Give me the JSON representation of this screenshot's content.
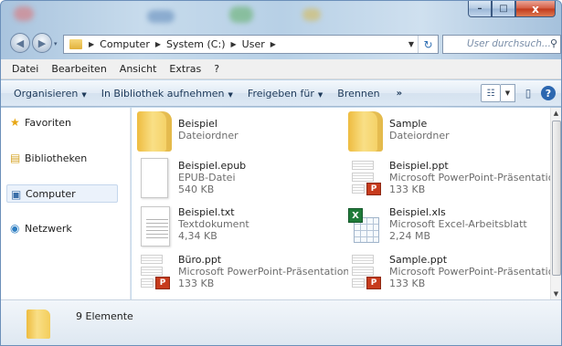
{
  "window": {
    "buttons": {
      "minimize": "–",
      "maximize": "□",
      "close": "x"
    }
  },
  "nav": {
    "back_icon": "arrow-left-icon",
    "forward_icon": "arrow-right-icon",
    "history_dropdown": "▾",
    "breadcrumbs": [
      "Computer",
      "System (C:)",
      "User"
    ],
    "search_placeholder": "User durchsuch..."
  },
  "menubar": {
    "items": [
      "Datei",
      "Bearbeiten",
      "Ansicht",
      "Extras",
      "?"
    ]
  },
  "toolbar": {
    "items": [
      "Organisieren",
      "In Bibliothek aufnehmen",
      "Freigeben für",
      "Brennen"
    ],
    "more": "»"
  },
  "navpane": {
    "items": [
      {
        "label": "Favoriten",
        "icon": "star-icon",
        "selected": false
      },
      {
        "label": "Bibliotheken",
        "icon": "libraries-icon",
        "selected": false
      },
      {
        "label": "Computer",
        "icon": "computer-icon",
        "selected": true
      },
      {
        "label": "Netzwerk",
        "icon": "network-icon",
        "selected": false
      }
    ]
  },
  "files": [
    {
      "name": "Beispiel",
      "type": "Dateiordner",
      "size": "",
      "icon": "folder-icon"
    },
    {
      "name": "Sample",
      "type": "Dateiordner",
      "size": "",
      "icon": "folder-icon"
    },
    {
      "name": "Beispiel.epub",
      "type": "EPUB-Datei",
      "size": "540 KB",
      "icon": "document-icon"
    },
    {
      "name": "Beispiel.ppt",
      "type": "Microsoft PowerPoint-Präsentation",
      "size": "133 KB",
      "icon": "powerpoint-icon"
    },
    {
      "name": "Beispiel.txt",
      "type": "Textdokument",
      "size": "4,34 KB",
      "icon": "text-file-icon"
    },
    {
      "name": "Beispiel.xls",
      "type": "Microsoft Excel-Arbeitsblatt",
      "size": "2,24 MB",
      "icon": "excel-icon"
    },
    {
      "name": "Büro.ppt",
      "type": "Microsoft PowerPoint-Präsentation",
      "size": "133 KB",
      "icon": "powerpoint-icon"
    },
    {
      "name": "Sample.ppt",
      "type": "Microsoft PowerPoint-Präsentation",
      "size": "133 KB",
      "icon": "powerpoint-icon"
    }
  ],
  "details": {
    "count": "9 Elemente"
  },
  "colors": {
    "accent": "#2c67b0",
    "selection": "#ebf2fb",
    "ppt": "#c73b1d",
    "xls": "#1f7b39"
  }
}
